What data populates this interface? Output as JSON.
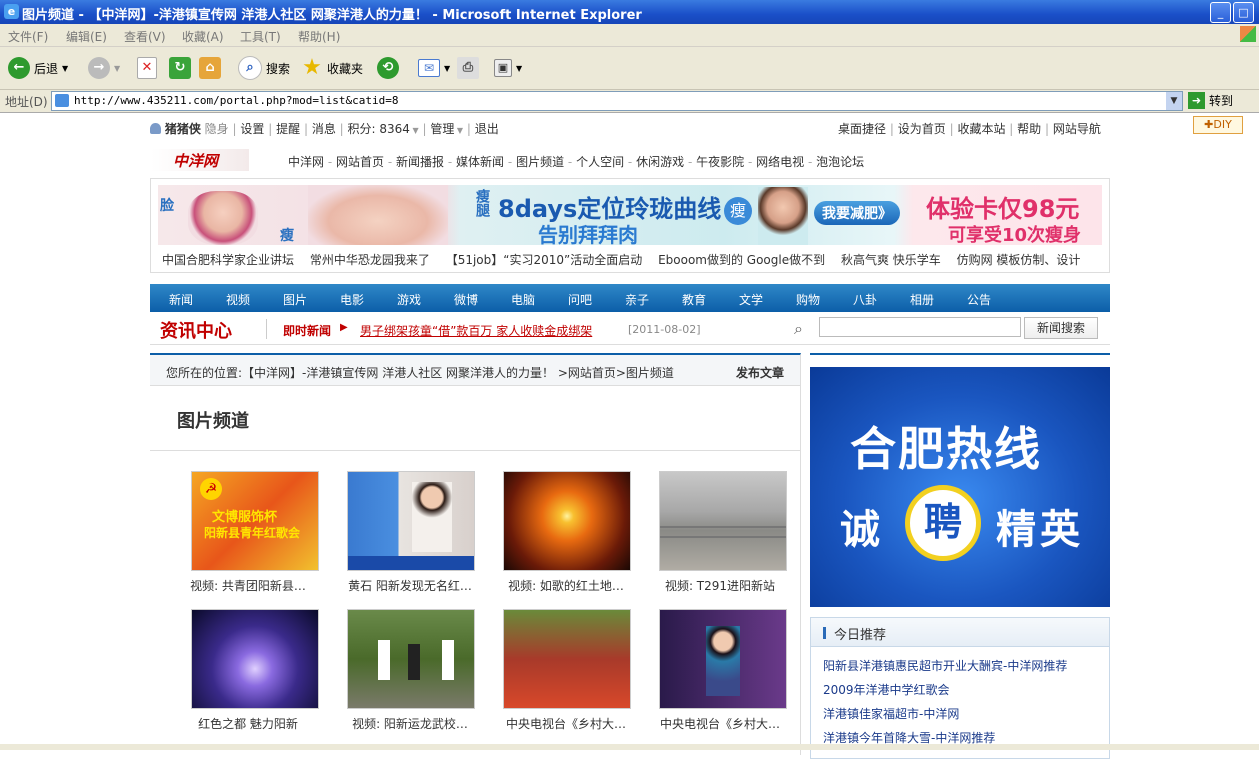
{
  "window": {
    "title": "图片频道 - 【中洋网】-洋港镇宣传网 洋港人社区 网聚洋港人的力量！ - Microsoft Internet Explorer"
  },
  "menu": [
    "文件(F)",
    "编辑(E)",
    "查看(V)",
    "收藏(A)",
    "工具(T)",
    "帮助(H)"
  ],
  "toolbar": {
    "back": "后退",
    "search": "搜索",
    "favorites": "收藏夹"
  },
  "address": {
    "label": "地址(D)",
    "url": "http://www.435211.com/portal.php?mod=list&catid=8",
    "go": "转到"
  },
  "userbar": {
    "username": "猪猪侠",
    "hide": "隐身",
    "settings": "设置",
    "remind": "提醒",
    "messages": "消息",
    "points": "积分: 8364",
    "manage": "管理",
    "logout": "退出",
    "right": [
      "桌面捷径",
      "设为首页",
      "收藏本站",
      "帮助",
      "网站导航"
    ],
    "diy": "DIY"
  },
  "logo": "中洋网",
  "sitenav": [
    "中洋网",
    "网站首页",
    "新闻播报",
    "媒体新闻",
    "图片频道",
    "个人空间",
    "休闲游戏",
    "午夜影院",
    "网络电视",
    "泡泡论坛"
  ],
  "banner": {
    "headline": "8days定位玲珑曲线",
    "sub": "告别拜拜肉",
    "shou": "瘦",
    "btn": "我要减肥》",
    "offer1": "体验卡仅98元",
    "offer2": "可享受10次瘦身",
    "left_tags": [
      "脸",
      "瘦",
      "瘦腿"
    ]
  },
  "adlinks": [
    "中国合肥科学家企业讲坛",
    "常州中华恐龙园我来了",
    "【51job】“实习2010”活动全面启动",
    "Ebooom做到的 Google做不到",
    "秋高气爽 快乐学车",
    "仿购网 模板仿制、设计"
  ],
  "channels": [
    "新闻",
    "视频",
    "图片",
    "电影",
    "游戏",
    "微博",
    "电脑",
    "问吧",
    "亲子",
    "教育",
    "文学",
    "购物",
    "八卦",
    "相册",
    "公告"
  ],
  "newsbar": {
    "section": "资讯中心",
    "label": "即时新闻",
    "headline": "男子绑架孩童“借”款百万 家人收赎金成绑架",
    "date": "[2011-08-02]",
    "search_btn": "新闻搜索",
    "search_value": ""
  },
  "breadcrumb": {
    "text": "您所在的位置:【中洋网】-洋港镇宣传网 洋港人社区 网聚洋港人的力量！ >网站首页>图片频道",
    "publish": "发布文章"
  },
  "page_title": "图片频道",
  "thumbs": [
    {
      "caption": "视频: 共青团阳新县…",
      "text1": "文博服饰杯",
      "text2": "阳新县青年红歌会"
    },
    {
      "caption": "黄石 阳新发现无名红…"
    },
    {
      "caption": "视频: 如歌的红土地…"
    },
    {
      "caption": "视频: T291进阳新站"
    },
    {
      "caption": "红色之都 魅力阳新"
    },
    {
      "caption": "视频: 阳新运龙武校…"
    },
    {
      "caption": "中央电视台《乡村大…"
    },
    {
      "caption": "中央电视台《乡村大…"
    }
  ],
  "sidead": {
    "line1": "合肥热线",
    "left": "诚",
    "mid": "聘",
    "right": "精英"
  },
  "today": {
    "title": "今日推荐",
    "items": [
      "阳新县洋港镇惠民超市开业大酬宾-中洋网推荐",
      "2009年洋港中学红歌会",
      "洋港镇佳家福超市-中洋网",
      "洋港镇今年首降大雪-中洋网推荐"
    ]
  },
  "colors": {
    "titlebar": "#1a4fc8",
    "chanbar": "#0c5ea8",
    "accent_red": "#c00000",
    "sidead": "#1a56c0"
  }
}
